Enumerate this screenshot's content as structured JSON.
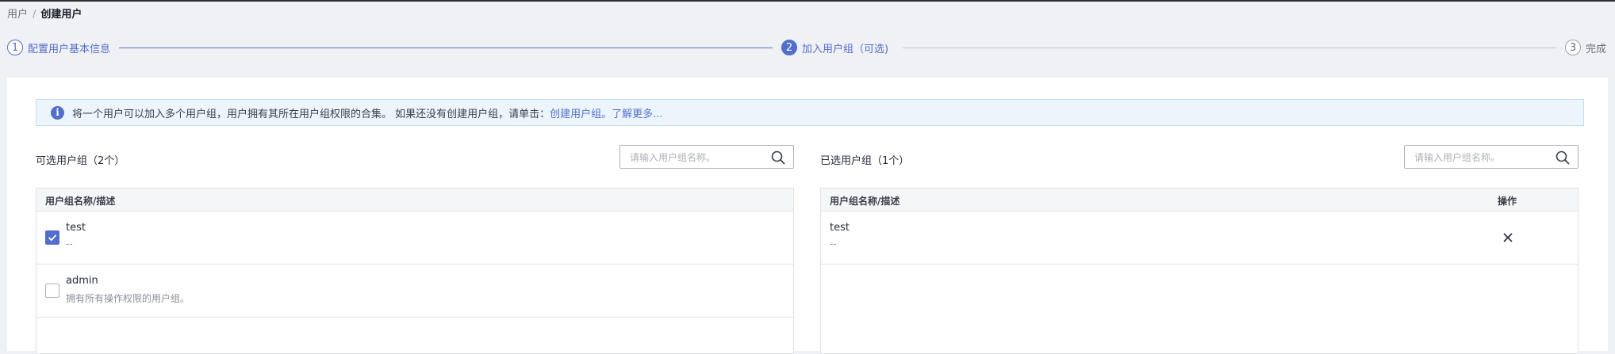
{
  "breadcrumb": {
    "parent": "用户",
    "separator": "/",
    "current": "创建用户"
  },
  "steps": [
    {
      "number": "1",
      "label": "配置用户基本信息",
      "state": "done"
    },
    {
      "number": "2",
      "label": "加入用户组（可选)",
      "state": "active"
    },
    {
      "number": "3",
      "label": "完成",
      "state": "todo"
    }
  ],
  "alert": {
    "text": "将一个用户可以加入多个用户组，用户拥有其所在用户组权限的合集。 如果还没有创建用户组，请单击：",
    "create_link": "创建用户组。",
    "learn_more_link": "了解更多..."
  },
  "available": {
    "title": "可选用户组（2个）",
    "search_placeholder": "请输入用户组名称。",
    "column_header": "用户组名称/描述",
    "rows": [
      {
        "name": "test",
        "description": "--",
        "checked": true
      },
      {
        "name": "admin",
        "description": "拥有所有操作权限的用户组。",
        "checked": false
      }
    ]
  },
  "selected": {
    "title": "已选用户组（1个）",
    "search_placeholder": "请输入用户组名称。",
    "column_header": "用户组名称/描述",
    "action_header": "操作",
    "rows": [
      {
        "name": "test",
        "description": "--"
      }
    ]
  },
  "colors": {
    "accent": "#526ecc",
    "alert_bg": "#edf5fc",
    "page_bg": "#f0f1f5"
  }
}
